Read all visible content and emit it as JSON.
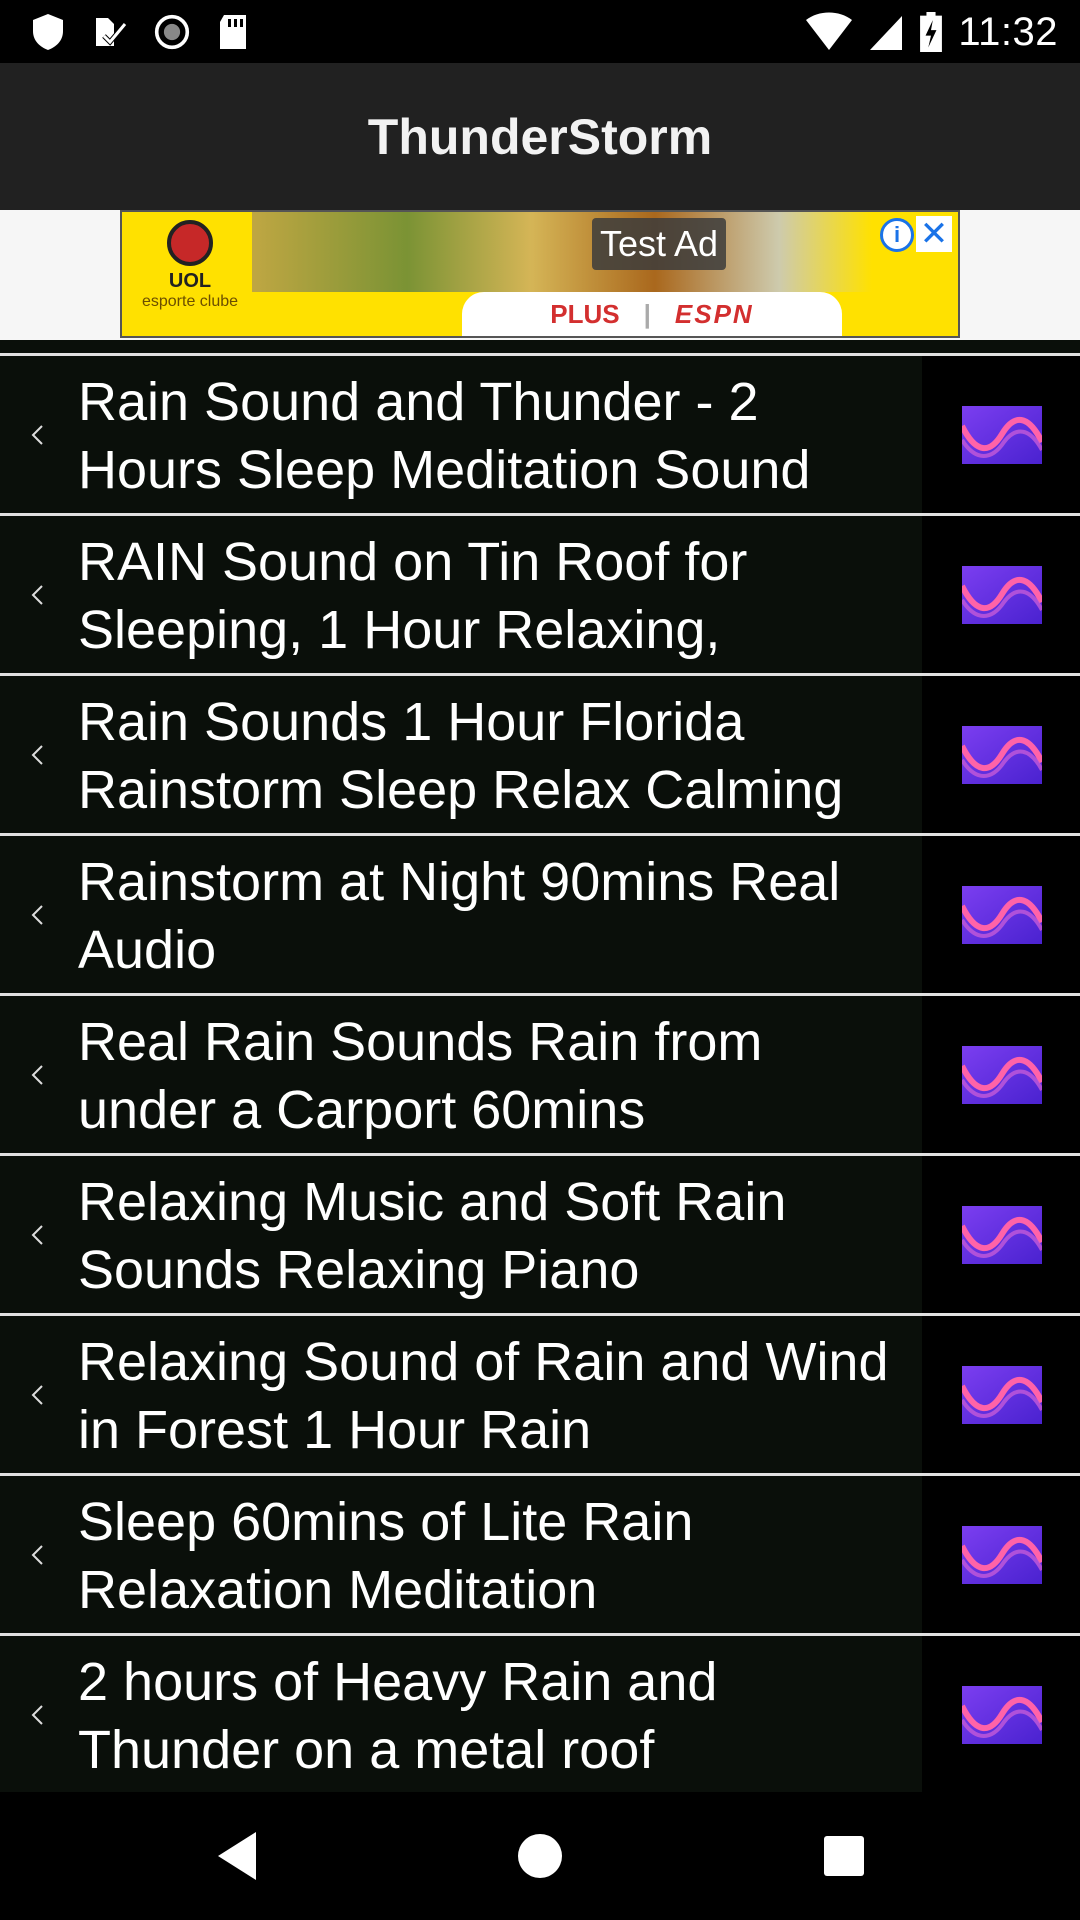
{
  "status_bar": {
    "time": "11:32",
    "left_icons": [
      "shield-icon",
      "download-check-icon",
      "record-icon",
      "sd-card-icon"
    ],
    "right_icons": [
      "wifi-icon",
      "cell-signal-icon",
      "battery-charging-icon"
    ]
  },
  "app_bar": {
    "title": "ThunderStorm"
  },
  "ad": {
    "label": "Test Ad",
    "logo_line1": "UOL",
    "logo_line2": "esporte clube",
    "plus_text": "PLUS",
    "espn_text": "ESPN",
    "info_icon": "info-icon",
    "close_icon": "close-icon"
  },
  "list": {
    "items": [
      {
        "title": "Rain Sound and Thunder - 2 Hours Sleep Meditation Sound"
      },
      {
        "title": "RAIN Sound on Tin Roof for Sleeping, 1 Hour Relaxing,"
      },
      {
        "title": "Rain Sounds 1 Hour Florida Rainstorm Sleep Relax Calming"
      },
      {
        "title": "Rainstorm at Night 90mins Real Audio"
      },
      {
        "title": "Real Rain Sounds Rain from under a Carport 60mins"
      },
      {
        "title": "Relaxing Music and Soft Rain Sounds Relaxing Piano"
      },
      {
        "title": "Relaxing Sound of Rain and Wind in Forest 1 Hour Rain"
      },
      {
        "title": "Sleep 60mins of Lite Rain Relaxation Meditation"
      },
      {
        "title": "2 hours of Heavy Rain and Thunder on a metal roof"
      }
    ]
  },
  "nav_bar": {
    "back_icon": "back-triangle-icon",
    "home_icon": "home-circle-icon",
    "recents_icon": "recents-square-icon"
  },
  "colors": {
    "app_bar_bg": "#212121",
    "row_bg": "#0a0f0a",
    "divider": "#e0e0e0",
    "ad_bg": "#ffe100",
    "wave_purple": "#5b2ee0",
    "wave_pink": "#ff5fa0"
  }
}
